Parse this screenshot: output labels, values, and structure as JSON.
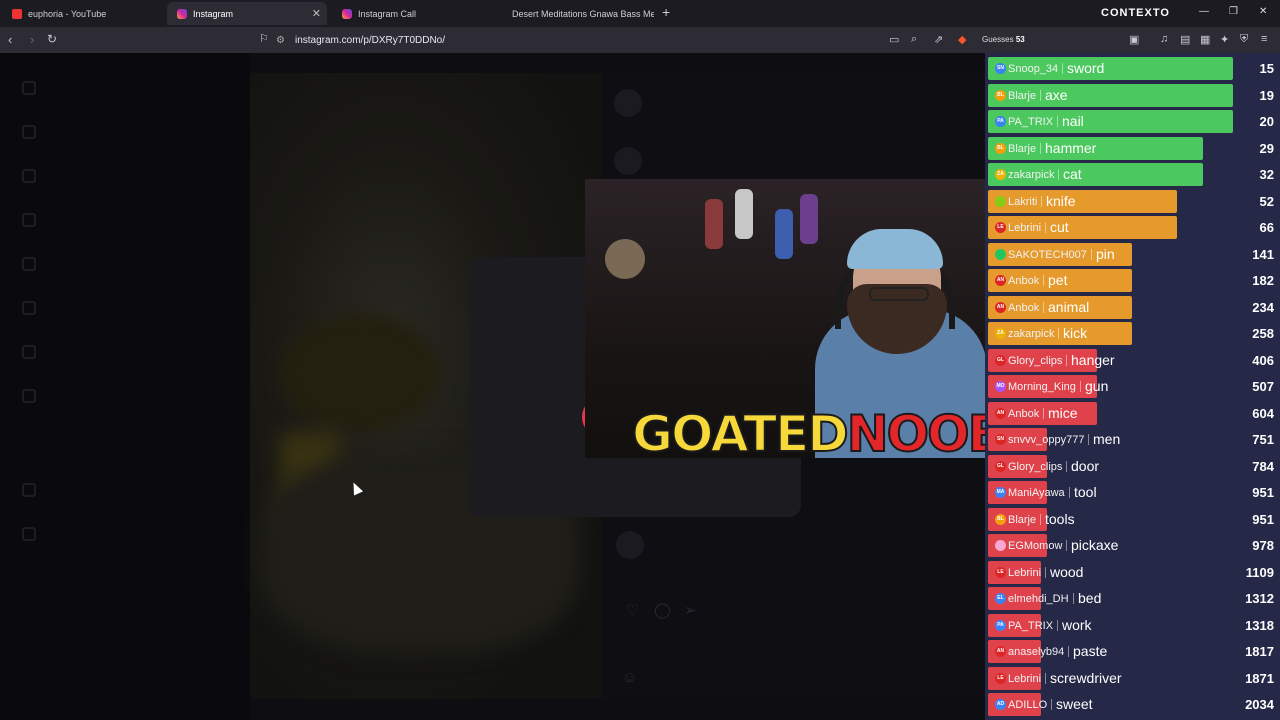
{
  "tabs": [
    {
      "title": "euphoria - YouTube",
      "icon": "youtube-icon",
      "active": false
    },
    {
      "title": "Instagram",
      "icon": "instagram-icon",
      "active": true
    },
    {
      "title": "Instagram Call",
      "icon": "instagram-icon",
      "active": false
    },
    {
      "title": "Desert Meditations Gnawa Bass Meets",
      "icon": "youtube-icon",
      "active": false
    }
  ],
  "window_title": "CONTEXTO",
  "address": "instagram.com/p/DXRy7T0DDNo/",
  "guesses": {
    "label": "Guesses",
    "count": "53"
  },
  "overlay_text": {
    "part1": "GOATED",
    "part2": "NOOB"
  },
  "colors": {
    "green": "#4bc95e",
    "orange": "#e59a2b",
    "red": "#e0424c",
    "board_bg": "#262848"
  },
  "leaderboard": [
    {
      "user": "Snoop_34",
      "word": "sword",
      "rank": "15",
      "color": "green",
      "fill": 0.92,
      "badge": "#3b82f6",
      "initials": "SN"
    },
    {
      "user": "Blarje",
      "word": "axe",
      "rank": "19",
      "color": "green",
      "fill": 0.92,
      "badge": "#f59e0b",
      "initials": "BL"
    },
    {
      "user": "PA_TRIX",
      "word": "nail",
      "rank": "20",
      "color": "green",
      "fill": 0.92,
      "badge": "#3b82f6",
      "initials": "PA"
    },
    {
      "user": "Blarje",
      "word": "hammer",
      "rank": "29",
      "color": "green",
      "fill": 0.81,
      "badge": "#f59e0b",
      "initials": "BL"
    },
    {
      "user": "zakarpick",
      "word": "cat",
      "rank": "32",
      "color": "green",
      "fill": 0.81,
      "badge": "#eab308",
      "initials": "ZA"
    },
    {
      "user": "Lakriti",
      "word": "knife",
      "rank": "52",
      "color": "orange",
      "fill": 0.71,
      "badge": "#84cc16",
      "initials": ""
    },
    {
      "user": "Lebrini",
      "word": "cut",
      "rank": "66",
      "color": "orange",
      "fill": 0.71,
      "badge": "#dc2626",
      "initials": "LE"
    },
    {
      "user": "SAKOTECH007",
      "word": "pin",
      "rank": "141",
      "color": "orange",
      "fill": 0.54,
      "badge": "#22c55e",
      "initials": ""
    },
    {
      "user": "Anbok",
      "word": "pet",
      "rank": "182",
      "color": "orange",
      "fill": 0.54,
      "badge": "#dc2626",
      "initials": "AN"
    },
    {
      "user": "Anbok",
      "word": "animal",
      "rank": "234",
      "color": "orange",
      "fill": 0.54,
      "badge": "#dc2626",
      "initials": "AN"
    },
    {
      "user": "zakarpick",
      "word": "kick",
      "rank": "258",
      "color": "orange",
      "fill": 0.54,
      "badge": "#eab308",
      "initials": "ZA"
    },
    {
      "user": "Glory_clips",
      "word": "hanger",
      "rank": "406",
      "color": "red",
      "fill": 0.41,
      "badge": "#dc2626",
      "initials": "GL"
    },
    {
      "user": "Morning_King",
      "word": "gun",
      "rank": "507",
      "color": "red",
      "fill": 0.41,
      "badge": "#a855f7",
      "initials": "MO"
    },
    {
      "user": "Anbok",
      "word": "mice",
      "rank": "604",
      "color": "red",
      "fill": 0.41,
      "badge": "#dc2626",
      "initials": "AN"
    },
    {
      "user": "snvvv_oppy777",
      "word": "men",
      "rank": "751",
      "color": "red",
      "fill": 0.22,
      "badge": "#dc2626",
      "initials": "SN"
    },
    {
      "user": "Glory_clips",
      "word": "door",
      "rank": "784",
      "color": "red",
      "fill": 0.22,
      "badge": "#dc2626",
      "initials": "GL"
    },
    {
      "user": "ManiAyawa",
      "word": "tool",
      "rank": "951",
      "color": "red",
      "fill": 0.22,
      "badge": "#3b82f6",
      "initials": "MA"
    },
    {
      "user": "Blarje",
      "word": "tools",
      "rank": "951",
      "color": "red",
      "fill": 0.22,
      "badge": "#f59e0b",
      "initials": "BL"
    },
    {
      "user": "EGMomow",
      "word": "pickaxe",
      "rank": "978",
      "color": "red",
      "fill": 0.22,
      "badge": "#f9a8d4",
      "initials": ""
    },
    {
      "user": "Lebrini",
      "word": "wood",
      "rank": "1109",
      "color": "red",
      "fill": 0.2,
      "badge": "#dc2626",
      "initials": "LE"
    },
    {
      "user": "elmehdi_DH",
      "word": "bed",
      "rank": "1312",
      "color": "red",
      "fill": 0.2,
      "badge": "#3b82f6",
      "initials": "EL"
    },
    {
      "user": "PA_TRIX",
      "word": "work",
      "rank": "1318",
      "color": "red",
      "fill": 0.2,
      "badge": "#3b82f6",
      "initials": "PA"
    },
    {
      "user": "anaselyb94",
      "word": "paste",
      "rank": "1817",
      "color": "red",
      "fill": 0.2,
      "badge": "#dc2626",
      "initials": "AN"
    },
    {
      "user": "Lebrini",
      "word": "screwdriver",
      "rank": "1871",
      "color": "red",
      "fill": 0.2,
      "badge": "#dc2626",
      "initials": "LE"
    },
    {
      "user": "ADILLO",
      "word": "sweet",
      "rank": "2034",
      "color": "red",
      "fill": 0.2,
      "badge": "#3b82f6",
      "initials": "AD"
    }
  ]
}
